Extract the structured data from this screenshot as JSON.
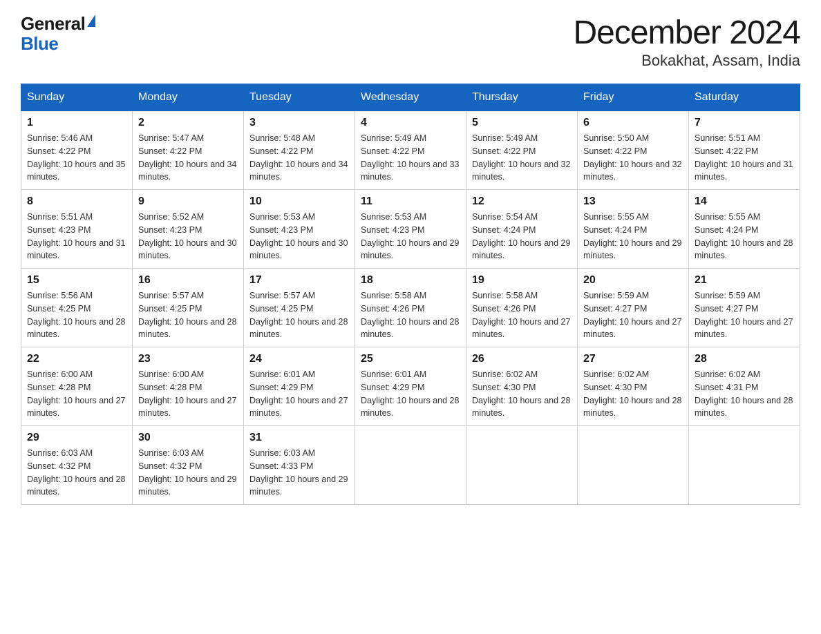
{
  "logo": {
    "general": "General",
    "blue": "Blue"
  },
  "title": {
    "month_year": "December 2024",
    "location": "Bokakhat, Assam, India"
  },
  "days_of_week": [
    "Sunday",
    "Monday",
    "Tuesday",
    "Wednesday",
    "Thursday",
    "Friday",
    "Saturday"
  ],
  "weeks": [
    [
      {
        "day": "1",
        "sunrise": "5:46 AM",
        "sunset": "4:22 PM",
        "daylight": "10 hours and 35 minutes."
      },
      {
        "day": "2",
        "sunrise": "5:47 AM",
        "sunset": "4:22 PM",
        "daylight": "10 hours and 34 minutes."
      },
      {
        "day": "3",
        "sunrise": "5:48 AM",
        "sunset": "4:22 PM",
        "daylight": "10 hours and 34 minutes."
      },
      {
        "day": "4",
        "sunrise": "5:49 AM",
        "sunset": "4:22 PM",
        "daylight": "10 hours and 33 minutes."
      },
      {
        "day": "5",
        "sunrise": "5:49 AM",
        "sunset": "4:22 PM",
        "daylight": "10 hours and 32 minutes."
      },
      {
        "day": "6",
        "sunrise": "5:50 AM",
        "sunset": "4:22 PM",
        "daylight": "10 hours and 32 minutes."
      },
      {
        "day": "7",
        "sunrise": "5:51 AM",
        "sunset": "4:22 PM",
        "daylight": "10 hours and 31 minutes."
      }
    ],
    [
      {
        "day": "8",
        "sunrise": "5:51 AM",
        "sunset": "4:23 PM",
        "daylight": "10 hours and 31 minutes."
      },
      {
        "day": "9",
        "sunrise": "5:52 AM",
        "sunset": "4:23 PM",
        "daylight": "10 hours and 30 minutes."
      },
      {
        "day": "10",
        "sunrise": "5:53 AM",
        "sunset": "4:23 PM",
        "daylight": "10 hours and 30 minutes."
      },
      {
        "day": "11",
        "sunrise": "5:53 AM",
        "sunset": "4:23 PM",
        "daylight": "10 hours and 29 minutes."
      },
      {
        "day": "12",
        "sunrise": "5:54 AM",
        "sunset": "4:24 PM",
        "daylight": "10 hours and 29 minutes."
      },
      {
        "day": "13",
        "sunrise": "5:55 AM",
        "sunset": "4:24 PM",
        "daylight": "10 hours and 29 minutes."
      },
      {
        "day": "14",
        "sunrise": "5:55 AM",
        "sunset": "4:24 PM",
        "daylight": "10 hours and 28 minutes."
      }
    ],
    [
      {
        "day": "15",
        "sunrise": "5:56 AM",
        "sunset": "4:25 PM",
        "daylight": "10 hours and 28 minutes."
      },
      {
        "day": "16",
        "sunrise": "5:57 AM",
        "sunset": "4:25 PM",
        "daylight": "10 hours and 28 minutes."
      },
      {
        "day": "17",
        "sunrise": "5:57 AM",
        "sunset": "4:25 PM",
        "daylight": "10 hours and 28 minutes."
      },
      {
        "day": "18",
        "sunrise": "5:58 AM",
        "sunset": "4:26 PM",
        "daylight": "10 hours and 28 minutes."
      },
      {
        "day": "19",
        "sunrise": "5:58 AM",
        "sunset": "4:26 PM",
        "daylight": "10 hours and 27 minutes."
      },
      {
        "day": "20",
        "sunrise": "5:59 AM",
        "sunset": "4:27 PM",
        "daylight": "10 hours and 27 minutes."
      },
      {
        "day": "21",
        "sunrise": "5:59 AM",
        "sunset": "4:27 PM",
        "daylight": "10 hours and 27 minutes."
      }
    ],
    [
      {
        "day": "22",
        "sunrise": "6:00 AM",
        "sunset": "4:28 PM",
        "daylight": "10 hours and 27 minutes."
      },
      {
        "day": "23",
        "sunrise": "6:00 AM",
        "sunset": "4:28 PM",
        "daylight": "10 hours and 27 minutes."
      },
      {
        "day": "24",
        "sunrise": "6:01 AM",
        "sunset": "4:29 PM",
        "daylight": "10 hours and 27 minutes."
      },
      {
        "day": "25",
        "sunrise": "6:01 AM",
        "sunset": "4:29 PM",
        "daylight": "10 hours and 28 minutes."
      },
      {
        "day": "26",
        "sunrise": "6:02 AM",
        "sunset": "4:30 PM",
        "daylight": "10 hours and 28 minutes."
      },
      {
        "day": "27",
        "sunrise": "6:02 AM",
        "sunset": "4:30 PM",
        "daylight": "10 hours and 28 minutes."
      },
      {
        "day": "28",
        "sunrise": "6:02 AM",
        "sunset": "4:31 PM",
        "daylight": "10 hours and 28 minutes."
      }
    ],
    [
      {
        "day": "29",
        "sunrise": "6:03 AM",
        "sunset": "4:32 PM",
        "daylight": "10 hours and 28 minutes."
      },
      {
        "day": "30",
        "sunrise": "6:03 AM",
        "sunset": "4:32 PM",
        "daylight": "10 hours and 29 minutes."
      },
      {
        "day": "31",
        "sunrise": "6:03 AM",
        "sunset": "4:33 PM",
        "daylight": "10 hours and 29 minutes."
      },
      null,
      null,
      null,
      null
    ]
  ]
}
